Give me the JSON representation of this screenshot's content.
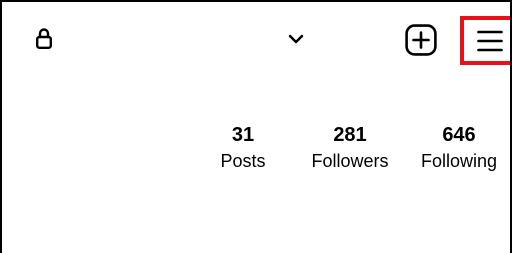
{
  "header": {
    "lock_icon": "lock-icon",
    "dropdown_icon": "chevron-down-icon",
    "create_icon": "plus-square-icon",
    "menu_icon": "hamburger-menu-icon",
    "highlight_color": "#e8101a"
  },
  "stats": [
    {
      "value": "31",
      "label": "Posts"
    },
    {
      "value": "281",
      "label": "Followers"
    },
    {
      "value": "646",
      "label": "Following"
    }
  ]
}
